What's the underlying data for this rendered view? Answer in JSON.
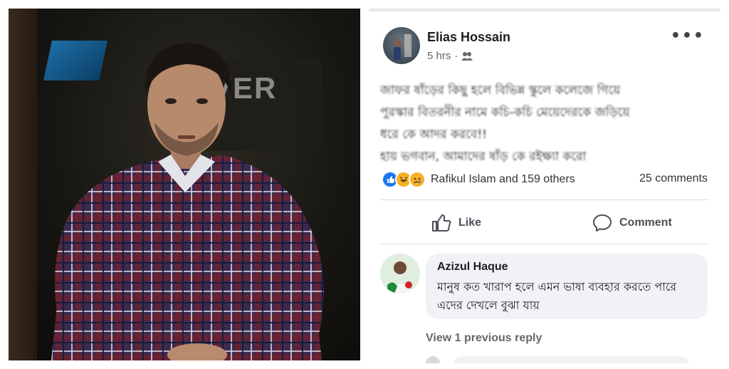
{
  "photo": {
    "channel_logo_line1": "",
    "channel_logo_line2": "",
    "show_logo": "VER"
  },
  "post": {
    "author": "Elias Hossain",
    "time": "5 hrs",
    "separator": "·",
    "privacy_icon": "friends-icon",
    "more_label": "•••",
    "body": "জাফর ষাঁড়ের কিছু হলে বিভিন্ন স্কুলে কলেজে গিয়ে\nপুরস্কার বিতরনীর নামে কচি-কচি মেয়েদেরকে জড়িয়ে\nধরে কে আদর করবে!!\nহায় ভগবান, আমাদের ষাঁড় কে রইক্ষ্যা করো",
    "reactions": [
      "like",
      "haha",
      "sad"
    ],
    "reactors": "Rafikul Islam and 159 others",
    "comments_count": "25 comments",
    "like_label": "Like",
    "comment_label": "Comment"
  },
  "comment": {
    "author": "Azizul Haque",
    "text": "মানুষ কত খারাপ হলে এমন ভাষা ব্যবহার করতে পারে এদের দেখলে বুঝা যায়",
    "view_replies": "View 1 previous reply"
  },
  "colors": {
    "accent": "#1877f2",
    "bubble": "#f0f2f5",
    "muted": "#65676b"
  }
}
